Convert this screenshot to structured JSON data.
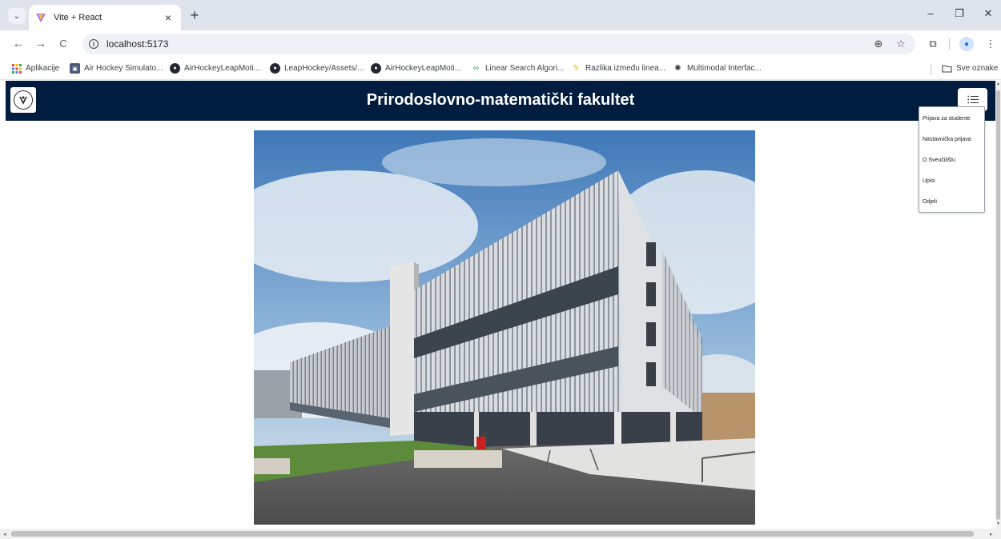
{
  "browser": {
    "tab_title": "Vite + React",
    "tab_close": "×",
    "new_tab": "+",
    "url": "localhost:5173",
    "nav": {
      "back": "←",
      "forward": "→",
      "reload": "C"
    },
    "window": {
      "minimize": "–",
      "restore": "❐",
      "close": "✕"
    }
  },
  "bookmarks": {
    "items": [
      {
        "label": "Aplikacije",
        "icon": "apps-grid-icon"
      },
      {
        "label": "Air Hockey Simulato...",
        "icon": "app-favicon-icon"
      },
      {
        "label": "AirHockeyLeapMoti...",
        "icon": "github-icon"
      },
      {
        "label": "LeapHockey/Assets/...",
        "icon": "github-icon"
      },
      {
        "label": "AirHockeyLeapMoti...",
        "icon": "github-icon"
      },
      {
        "label": "Linear Search Algori...",
        "icon": "link-icon"
      },
      {
        "label": "Razlika između linea...",
        "icon": "pencil-icon"
      },
      {
        "label": "Multimodal Interfac...",
        "icon": "chatgpt-icon"
      }
    ],
    "all_bookmarks": "Sve oznake"
  },
  "page": {
    "title": "Prirodoslovno-matematički fakultet",
    "menu": {
      "items": [
        "Prijava za studente",
        "Nastavnička prijava",
        "O Sveučilištu",
        "Upisi",
        "Odjeli"
      ]
    }
  },
  "colors": {
    "navbar": "#001c3e",
    "tabstrip": "#dfe3eb",
    "omnibox": "#eef1f6"
  }
}
